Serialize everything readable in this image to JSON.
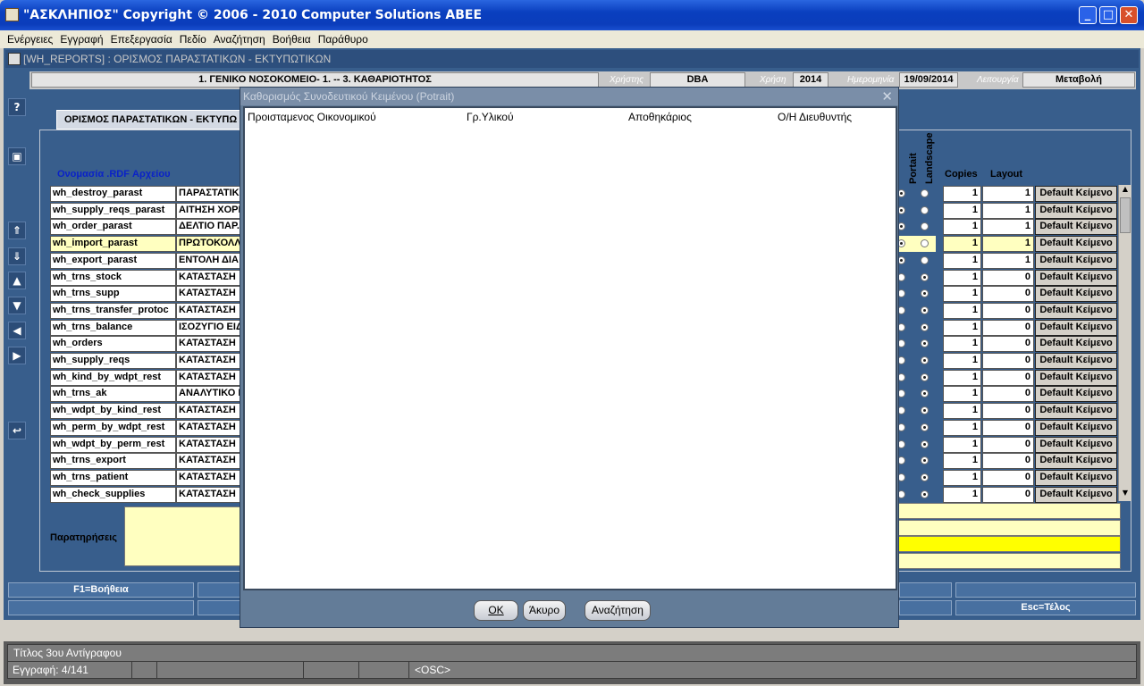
{
  "window": {
    "title": "\"ΑΣΚΛΗΠΙΟΣ\" Copyright © 2006 - 2010 Computer Solutions ABEE"
  },
  "menu": [
    "Ενέργειες",
    "Εγγραφή",
    "Επεξεργασία",
    "Πεδίο",
    "Αναζήτηση",
    "Βοήθεια",
    "Παράθυρο"
  ],
  "form": {
    "title": "[WH_REPORTS]   :   ΟΡΙΣΜΟΣ ΠΑΡΑΣΤΑΤΙΚΩΝ - ΕΚΤΥΠΩΤΙΚΩΝ"
  },
  "header": {
    "hospital": "1. ΓΕΝΙΚΟ ΝΟΣΟΚΟΜΕΙΟ- 1. -- 3. ΚΑΘΑΡΙΟΤΗΤΟΣ",
    "user_label": "Χρήστης",
    "user": "DBA",
    "year_label": "Χρήση",
    "year": "2014",
    "date_label": "Ημερομηνία",
    "date": "19/09/2014",
    "mode_label": "Λειτουργία",
    "mode": "Μεταβολή"
  },
  "tab": {
    "label": "ΟΡΙΣΜΟΣ ΠΑΡΑΣΤΑΤΙΚΩΝ - ΕΚΤΥΠΩ"
  },
  "columns": {
    "rdf": "Ονομασία .RDF Αρχείου",
    "portrait": "Portait",
    "landscape": "Landscape",
    "copies": "Copies",
    "layout": "Layout"
  },
  "rows": [
    {
      "rdf": "wh_destroy_parast",
      "desc": "ΠΑΡΑΣΤΑΤΙΚ",
      "portrait": true,
      "copies": "1",
      "layout": "1",
      "btn": "Default Κείμενο"
    },
    {
      "rdf": "wh_supply_reqs_parast",
      "desc": "ΑΙΤΗΣΗ ΧΟΡΗ",
      "portrait": true,
      "copies": "1",
      "layout": "1",
      "btn": "Default Κείμενο"
    },
    {
      "rdf": "wh_order_parast",
      "desc": "ΔΕΛΤΙΟ ΠΑΡ.",
      "portrait": true,
      "copies": "1",
      "layout": "1",
      "btn": "Default Κείμενο"
    },
    {
      "rdf": "wh_import_parast",
      "desc": "ΠΡΩΤΟΚΟΛΛ",
      "portrait": true,
      "copies": "1",
      "layout": "1",
      "btn": "Default Κείμενο"
    },
    {
      "rdf": "wh_export_parast",
      "desc": "ΕΝΤΟΛΗ ΔΙΑ",
      "portrait": true,
      "copies": "1",
      "layout": "1",
      "btn": "Default Κείμενο"
    },
    {
      "rdf": "wh_trns_stock",
      "desc": "ΚΑΤΑΣΤΑΣΗ",
      "portrait": false,
      "copies": "1",
      "layout": "0",
      "btn": "Default Κείμενο"
    },
    {
      "rdf": "wh_trns_supp",
      "desc": "ΚΑΤΑΣΤΑΣΗ",
      "portrait": false,
      "copies": "1",
      "layout": "0",
      "btn": "Default Κείμενο"
    },
    {
      "rdf": "wh_trns_transfer_protoc",
      "desc": "ΚΑΤΑΣΤΑΣΗ",
      "portrait": false,
      "copies": "1",
      "layout": "0",
      "btn": "Default Κείμενο"
    },
    {
      "rdf": "wh_trns_balance",
      "desc": "ΙΣΟΖΥΓΙΟ ΕΙΔ",
      "portrait": false,
      "copies": "1",
      "layout": "0",
      "btn": "Default Κείμενο"
    },
    {
      "rdf": "wh_orders",
      "desc": "ΚΑΤΑΣΤΑΣΗ",
      "portrait": false,
      "copies": "1",
      "layout": "0",
      "btn": "Default Κείμενο"
    },
    {
      "rdf": "wh_supply_reqs",
      "desc": "ΚΑΤΑΣΤΑΣΗ",
      "portrait": false,
      "copies": "1",
      "layout": "0",
      "btn": "Default Κείμενο"
    },
    {
      "rdf": "wh_kind_by_wdpt_rest",
      "desc": "ΚΑΤΑΣΤΑΣΗ",
      "portrait": false,
      "copies": "1",
      "layout": "0",
      "btn": "Default Κείμενο"
    },
    {
      "rdf": "wh_trns_ak",
      "desc": "ΑΝΑΛΥΤΙΚΟ Ι",
      "portrait": false,
      "copies": "1",
      "layout": "0",
      "btn": "Default Κείμενο"
    },
    {
      "rdf": "wh_wdpt_by_kind_rest",
      "desc": "ΚΑΤΑΣΤΑΣΗ",
      "portrait": false,
      "copies": "1",
      "layout": "0",
      "btn": "Default Κείμενο"
    },
    {
      "rdf": "wh_perm_by_wdpt_rest",
      "desc": "ΚΑΤΑΣΤΑΣΗ",
      "portrait": false,
      "copies": "1",
      "layout": "0",
      "btn": "Default Κείμενο"
    },
    {
      "rdf": "wh_wdpt_by_perm_rest",
      "desc": "ΚΑΤΑΣΤΑΣΗ",
      "portrait": false,
      "copies": "1",
      "layout": "0",
      "btn": "Default Κείμενο"
    },
    {
      "rdf": "wh_trns_export",
      "desc": "ΚΑΤΑΣΤΑΣΗ",
      "portrait": false,
      "copies": "1",
      "layout": "0",
      "btn": "Default Κείμενο"
    },
    {
      "rdf": "wh_trns_patient",
      "desc": "ΚΑΤΑΣΤΑΣΗ",
      "portrait": false,
      "copies": "1",
      "layout": "0",
      "btn": "Default Κείμενο"
    },
    {
      "rdf": "wh_check_supplies",
      "desc": "ΚΑΤΑΣΤΑΣΗ",
      "portrait": false,
      "copies": "1",
      "layout": "0",
      "btn": "Default Κείμενο"
    }
  ],
  "selected_row": 3,
  "remarks_label": "Παρατηρήσεις",
  "fkeys": {
    "help": "F1=Βοήθεια",
    "exit": "Esc=Τέλος"
  },
  "status": {
    "field": "Τίτλος 3ου Αντίγραφου",
    "record": "Εγγραφή: 4/141",
    "osc": "<OSC>"
  },
  "dialog": {
    "title": "Καθορισμός Συνοδευτικού Κειμένου (Potrait)",
    "texts": [
      "Προισταμενος Οικονομικού",
      "Γρ.Υλικού",
      "Αποθηκάριος",
      "Ο/Η Διευθυντής"
    ],
    "ok": "OK",
    "cancel": "Άκυρο",
    "search": "Αναζήτηση"
  }
}
